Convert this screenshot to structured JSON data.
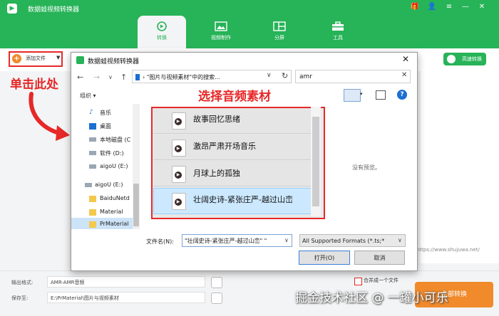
{
  "app": {
    "title": "数据蛙视频转换器",
    "tabs": [
      {
        "label": "转换",
        "active": true
      },
      {
        "label": "视频制作",
        "active": false
      },
      {
        "label": "分屏",
        "active": false
      },
      {
        "label": "工具",
        "active": false
      }
    ],
    "add_file_label": "添加文件",
    "hw_label": "高速转换",
    "red_hint": "单击此处",
    "url_text": "https://www.shujuwa.net/",
    "output_format_label": "输出格式:",
    "output_format_value": "AMR-AMR音频",
    "save_to_label": "保存至:",
    "save_to_value": "E:\\PrMaterial\\图片与视频素材",
    "merge_label": "合并成一个文件",
    "convert_label": "全部转换",
    "watermark": "掘金技术社区 @ 一罐小可乐"
  },
  "dialog": {
    "title": "数据蛙视频转换器",
    "address": "\"图片与视频素材\"中的搜索...",
    "search_value": "amr",
    "organize_label": "组织",
    "select_label": "选择音频素材",
    "tree": [
      "音乐",
      "桌面",
      "本地磁盘 (C",
      "软件 (D:)",
      "aigoU (E:)",
      "aigoU (E:)",
      "BaiduNetd",
      "Material",
      "PrMaterial"
    ],
    "files": [
      "故事回忆思绪",
      "激昂严肃开场音乐",
      "月球上的孤独",
      "壮阔史诗-紧张庄严-越过山峦"
    ],
    "no_preview": "没有预览。",
    "filename_label": "文件名(N):",
    "filename_value": "\"壮阔史诗-紧张庄严-越过山峦\" \"",
    "format_value": "All Supported Formats (*.ts;*",
    "open_label": "打开(O)",
    "cancel_label": "取消"
  },
  "colors": {
    "brand_green": "#27b358",
    "accent_orange": "#f08a2b",
    "annotation_red": "#e62828",
    "selection_blue": "#cce8ff"
  }
}
